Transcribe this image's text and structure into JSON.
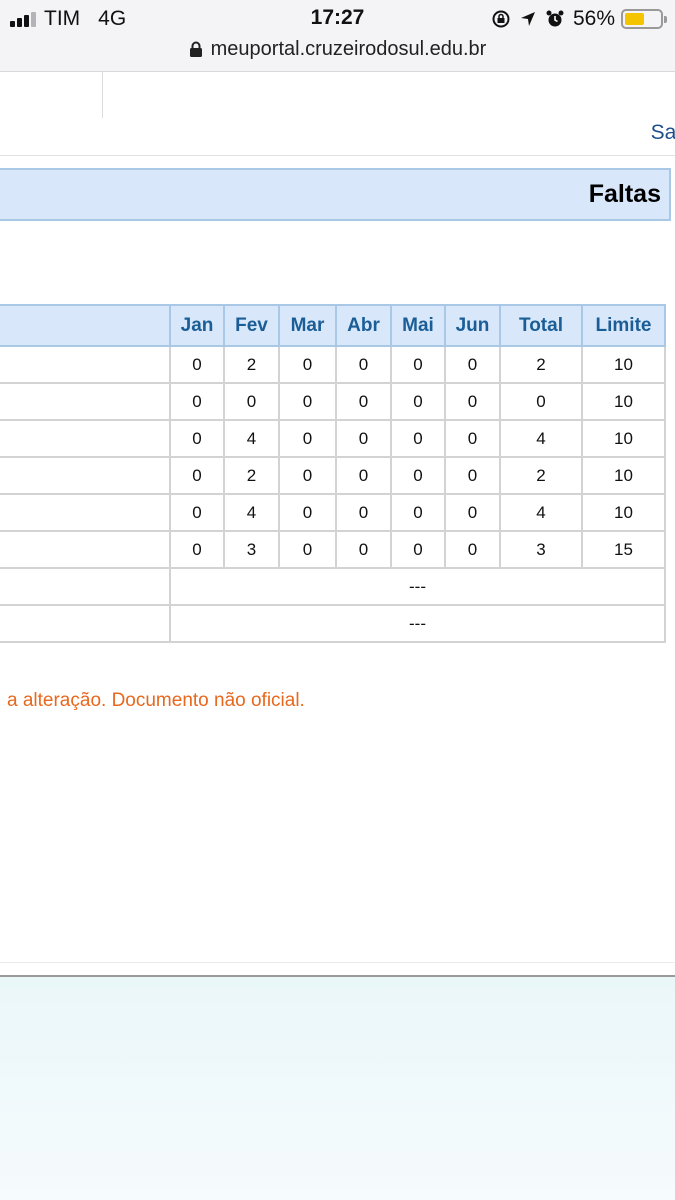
{
  "status_bar": {
    "carrier": "TIM",
    "network": "4G",
    "time": "17:27",
    "battery": "56%",
    "battery_level": 0.56,
    "icons": [
      "signal-icon",
      "rotation-lock-icon",
      "location-icon",
      "alarm-icon",
      "battery-icon"
    ]
  },
  "browser": {
    "url": "meuportal.cruzeirodosul.edu.br"
  },
  "header": {
    "logout_label": "Sai"
  },
  "section": {
    "title": "Faltas"
  },
  "table": {
    "columns": [
      "Jan",
      "Fev",
      "Mar",
      "Abr",
      "Mai",
      "Jun",
      "Total",
      "Limite"
    ],
    "rows": [
      [
        "0",
        "2",
        "0",
        "0",
        "0",
        "0",
        "2",
        "10"
      ],
      [
        "0",
        "0",
        "0",
        "0",
        "0",
        "0",
        "0",
        "10"
      ],
      [
        "0",
        "4",
        "0",
        "0",
        "0",
        "0",
        "4",
        "10"
      ],
      [
        "0",
        "2",
        "0",
        "0",
        "0",
        "0",
        "2",
        "10"
      ],
      [
        "0",
        "4",
        "0",
        "0",
        "0",
        "0",
        "4",
        "10"
      ],
      [
        "0",
        "3",
        "0",
        "0",
        "0",
        "0",
        "3",
        "15"
      ]
    ],
    "empty_rows": [
      "---",
      "---"
    ]
  },
  "notice": "a alteração. Documento não oficial.",
  "colors": {
    "header_bg": "#d8e8fa",
    "header_text": "#1b5e97",
    "notice": "#e8681e",
    "link": "#1e4f8c"
  }
}
